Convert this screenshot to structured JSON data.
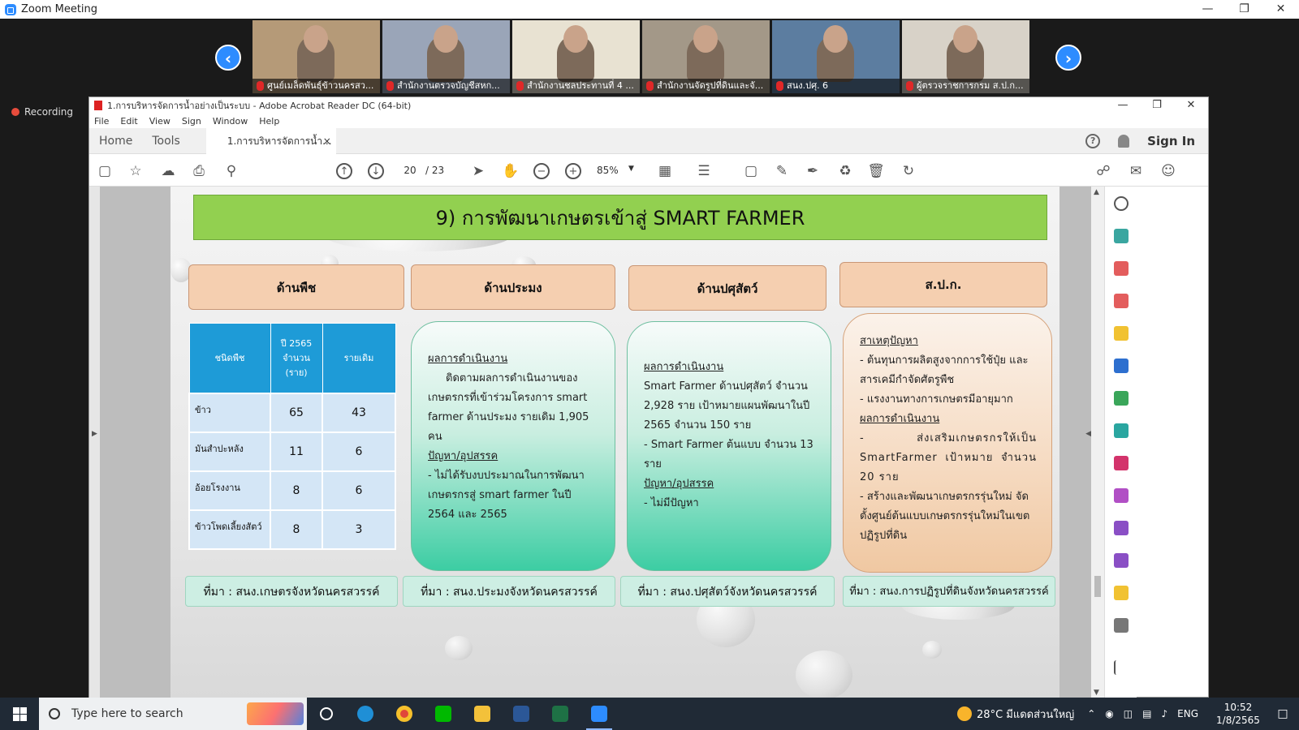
{
  "zoom": {
    "window_title": "Zoom Meeting",
    "recording_label": "Recording",
    "participants": [
      {
        "name": "ศูนย์เมล็ดพันธุ์ข้าวนครสว..."
      },
      {
        "name": "สำนักงานตรวจบัญชีสหก..."
      },
      {
        "name": "สำนักงานชลประทานที่ 4 ..."
      },
      {
        "name": "สำนักงานจัดรูปที่ดินและจั..."
      },
      {
        "name": "สนง.ปศุ. 6"
      },
      {
        "name": "ผู้ตรวจราชการกรม ส.ป.ก..."
      }
    ],
    "tile_colors": [
      "#b59a78",
      "#9aa5b8",
      "#e8e2d2",
      "#a39888",
      "#5c7da0",
      "#d8d2c8"
    ]
  },
  "acrobat": {
    "window_title": "1.การบริหารจัดการน้ำอย่างเป็นระบบ - Adobe Acrobat Reader DC (64-bit)",
    "menu": [
      "File",
      "Edit",
      "View",
      "Sign",
      "Window",
      "Help"
    ],
    "tabs": {
      "home": "Home",
      "tools": "Tools",
      "document": "1.การบริหารจัดการน้ำ...",
      "close": "×"
    },
    "sign_in": "Sign In",
    "page_current": "20",
    "page_total": "/ 23",
    "zoom": "85%"
  },
  "slide": {
    "title": "9) การพัฒนาเกษตรเข้าสู่  SMART FARMER",
    "categories": [
      "ด้านพืช",
      "ด้านประมง",
      "ด้านปศุสัตว์",
      "ส.ป.ก."
    ],
    "table": {
      "headers": [
        "ชนิดพืช",
        "ปี 2565 จำนวน (ราย)",
        "รายเดิม"
      ],
      "rows": [
        [
          "ข้าว",
          "65",
          "43"
        ],
        [
          "มันสำปะหลัง",
          "11",
          "6"
        ],
        [
          "อ้อยโรงงาน",
          "8",
          "6"
        ],
        [
          "ข้าวโพดเลี้ยงสัตว์",
          "8",
          "3"
        ]
      ]
    },
    "fishery": {
      "h1": "ผลการดำเนินงาน",
      "p1": "ติดตามผลการดำเนินงานของเกษตรกรที่เข้าร่วมโครงการ smart farmer ด้านประมง รายเดิม 1,905 คน",
      "h2": "ปัญหา/อุปสรรค",
      "p2": "-     ไม่ได้รับงบประมาณในการพัฒนาเกษตรกรสู่ smart farmer ในปี 2564 และ 2565"
    },
    "livestock": {
      "h1": "ผลการดำเนินงาน",
      "p1": "Smart Farmer ด้านปศุสัตว์ จำนวน 2,928 ราย เป้าหมายแผนพัฒนาในปี 2565 จำนวน 150 ราย",
      "p2": "- Smart Farmer ต้นแบบ จำนวน 13 ราย",
      "h2": "ปัญหา/อุปสรรค",
      "p3": "- ไม่มีปัญหา"
    },
    "alro": {
      "h1": "สาเหตุปัญหา",
      "p1": "- ต้นทุนการผลิตสูงจากการใช้ปุ๋ย และสารเคมีกำจัดศัตรูพืช",
      "p2": "- แรงงานทางการเกษตรมีอายุมาก",
      "h2": "ผลการดำเนินงาน",
      "p3": "- ส่งเสริมเกษตรกรให้เป็น SmartFarmer เป้าหมาย จำนวน 20 ราย",
      "p4": "- สร้างและพัฒนาเกษตรกรรุ่นใหม่ จัดตั้งศูนย์ต้นแบบเกษตรกรรุ่นใหม่ในเขตปฏิรูปที่ดิน"
    },
    "sources": [
      "ที่มา : สนง.เกษตรจังหวัดนครสวรรค์",
      "ที่มา : สนง.ประมงจังหวัดนครสวรรค์",
      "ที่มา : สนง.ปศุสัตว์จังหวัดนครสวรรค์",
      "ที่มา : สนง.การปฏิรูปที่ดินจังหวัดนครสวรรค์"
    ]
  },
  "taskbar": {
    "search_placeholder": "Type here to search",
    "weather": "28°C  มีแดดส่วนใหญ่",
    "language": "ENG",
    "time": "10:52",
    "date": "1/8/2565"
  },
  "colors": {
    "zoom_blue": "#2d8cff",
    "slide_header_green": "#92d050",
    "category_peach": "#f5cfb0",
    "table_header_blue": "#1e9bd7",
    "taskbar": "#202a36"
  }
}
